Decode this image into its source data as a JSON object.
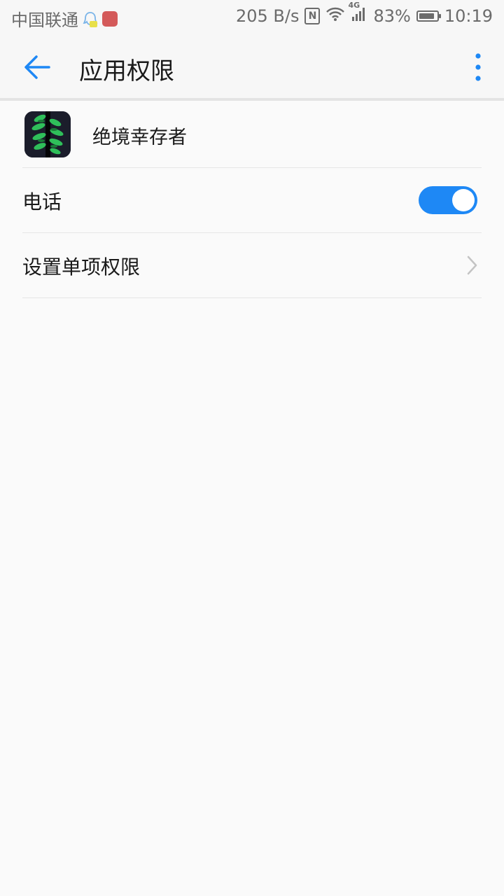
{
  "status_bar": {
    "carrier": "中国联通",
    "net_speed": "205 B/s",
    "network_type": "4G",
    "battery_percent": "83%",
    "time": "10:19",
    "icons": [
      "qq-notification-icon",
      "app-notification-icon",
      "nfc-icon",
      "wifi-icon",
      "signal-icon",
      "battery-icon"
    ]
  },
  "app_bar": {
    "title": "应用权限",
    "back_icon": "arrow-left-icon",
    "more_icon": "more-vertical-icon",
    "accent_color": "#1e88f5"
  },
  "app": {
    "name": "绝境幸存者",
    "icon": "app-icon"
  },
  "permissions": [
    {
      "label": "电话",
      "type": "toggle",
      "enabled": true
    },
    {
      "label": "设置单项权限",
      "type": "navigation",
      "icon": "chevron-right-icon"
    }
  ]
}
